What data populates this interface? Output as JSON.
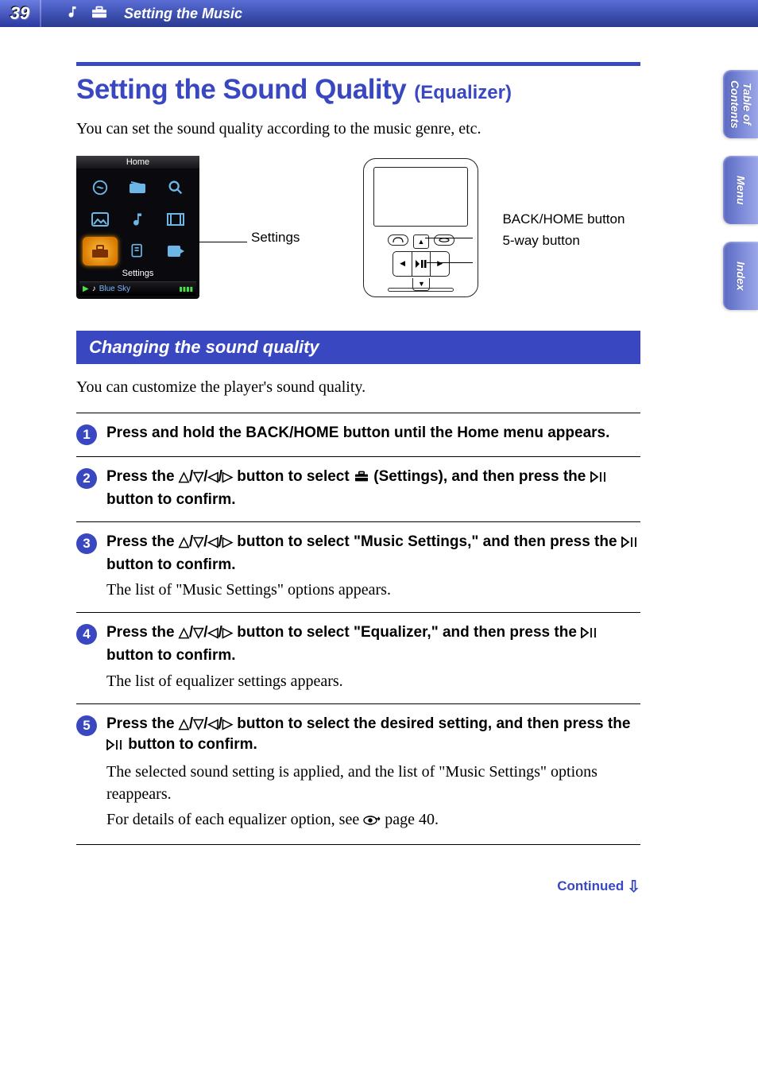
{
  "header": {
    "page_number": "39",
    "breadcrumb": "Setting the Music"
  },
  "side_tabs": [
    "Table of\nContents",
    "Menu",
    "Index"
  ],
  "title": {
    "main": "Setting the Sound Quality",
    "paren": "(Equalizer)"
  },
  "intro": "You can set the sound quality according to the music genre, etc.",
  "figure": {
    "screen_title": "Home",
    "selected_label": "Settings",
    "now_playing": "Blue Sky",
    "callout_settings": "Settings",
    "callout_back": "BACK/HOME button",
    "callout_fiveway": "5-way button"
  },
  "section_bar": "Changing the sound quality",
  "section_intro": "You can customize the player's sound quality.",
  "steps": [
    {
      "n": "1",
      "instruction_parts": [
        "Press and hold the BACK/HOME button until the Home menu appears."
      ],
      "result": ""
    },
    {
      "n": "2",
      "instruction_prefix": "Press the ",
      "instruction_mid": " button to select ",
      "instruction_settings": " (Settings), and then press the ",
      "instruction_suffix": " button to confirm.",
      "result": ""
    },
    {
      "n": "3",
      "instruction_prefix": "Press the ",
      "instruction_mid": " button to select \"Music Settings,\" and then press the ",
      "instruction_suffix": " button to confirm.",
      "result": "The list of \"Music Settings\" options appears."
    },
    {
      "n": "4",
      "instruction_prefix": "Press the ",
      "instruction_mid": " button to select \"Equalizer,\" and then press the ",
      "instruction_suffix": " button to confirm.",
      "result": "The list of equalizer settings appears."
    },
    {
      "n": "5",
      "instruction_prefix": "Press the ",
      "instruction_mid": " button to select the desired setting, and then press the ",
      "instruction_suffix": " button to confirm.",
      "result": "The selected sound setting is applied, and the list of \"Music Settings\" options reappears.",
      "result2_prefix": "For details of each equalizer option, see ",
      "result2_suffix": " page 40."
    }
  ],
  "continued": "Continued"
}
